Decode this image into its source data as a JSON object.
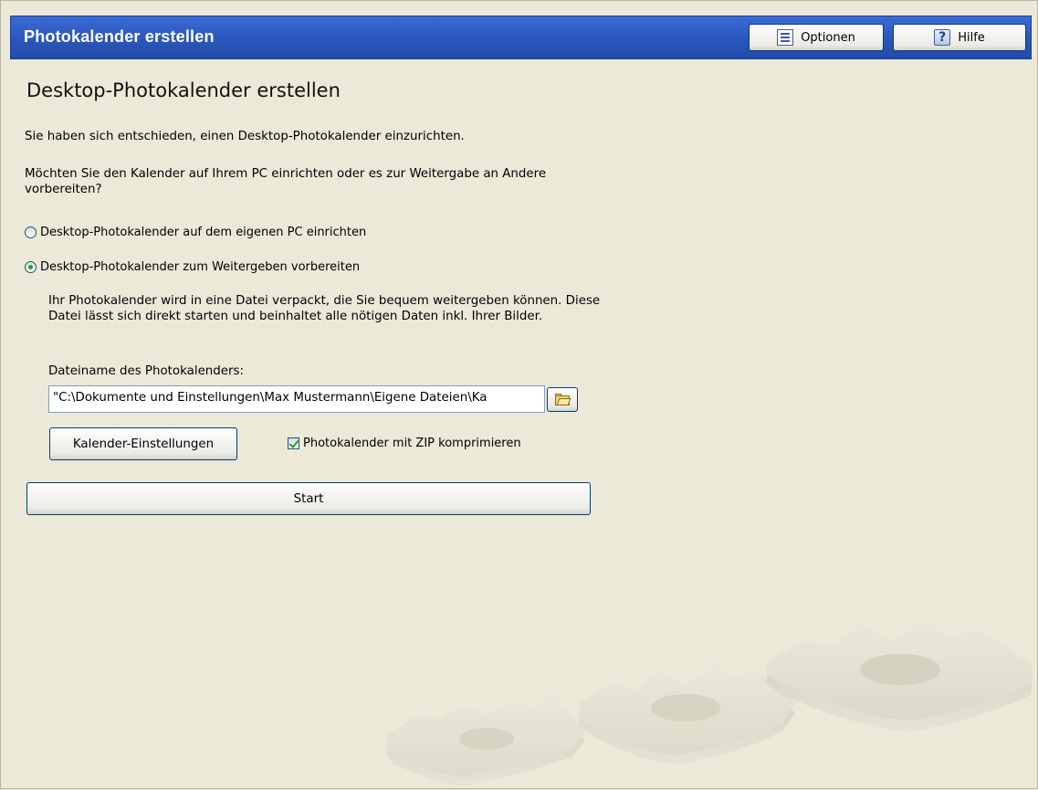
{
  "header": {
    "title": "Photokalender erstellen",
    "options_label": "Optionen",
    "help_label": "Hilfe"
  },
  "main": {
    "title": "Desktop-Photokalender erstellen",
    "intro": "Sie haben sich entschieden, einen Desktop-Photokalender einzurichten.",
    "question": " Möchten Sie den Kalender auf Ihrem PC einrichten oder es zur Weitergabe an Andere vorbereiten?",
    "radio_options": [
      {
        "label": "Desktop-Photokalender auf dem eigenen PC einrichten",
        "selected": false
      },
      {
        "label": "Desktop-Photokalender zum Weitergeben vorbereiten",
        "selected": true
      }
    ],
    "description": "Ihr Photokalender wird in eine Datei verpackt, die Sie bequem weitergeben können. Diese Datei lässt sich direkt starten und beinhaltet alle nötigen Daten inkl. Ihrer Bilder.",
    "filename_label": "Dateiname des Photokalenders:",
    "filename_value": "\"C:\\Dokumente und Einstellungen\\Max Mustermann\\Eigene Dateien\\Ka",
    "settings_button": "Kalender-Einstellungen",
    "zip_checkbox_label": "Photokalender mit ZIP komprimieren",
    "zip_checked": true,
    "start_button": "Start"
  },
  "colors": {
    "header_bg": "#2E5CC2",
    "window_bg": "#ECE9D8",
    "radio_dot": "#21A121"
  },
  "icons": {
    "options": "list-icon",
    "help": "help-icon",
    "browse": "folder-open-icon",
    "decoration": "gears-decoration"
  }
}
